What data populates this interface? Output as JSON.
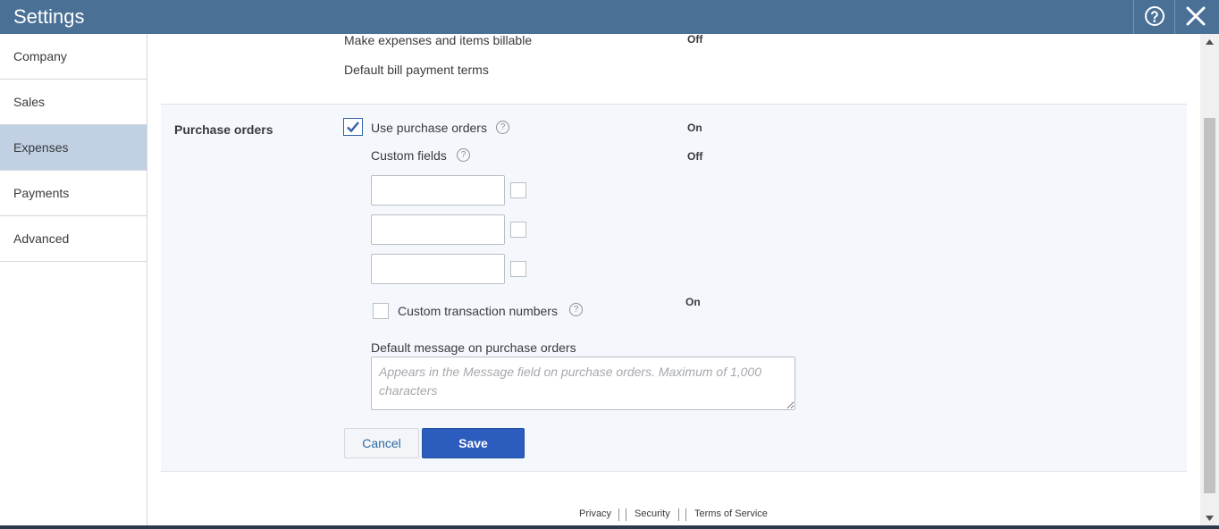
{
  "header": {
    "title": "Settings",
    "help_icon": "help-circle-icon",
    "close_icon": "close-icon"
  },
  "sidebar": {
    "items": [
      {
        "label": "Company",
        "active": false
      },
      {
        "label": "Sales",
        "active": false
      },
      {
        "label": "Expenses",
        "active": true
      },
      {
        "label": "Payments",
        "active": false
      },
      {
        "label": "Advanced",
        "active": false
      }
    ]
  },
  "bills": {
    "billable_label": "Make expenses and items billable",
    "billable_value": "Off",
    "payment_terms_label": "Default bill payment terms",
    "payment_terms_value": ""
  },
  "purchase_orders": {
    "section_title": "Purchase orders",
    "use_po_label": "Use purchase orders",
    "use_po_checked": true,
    "use_po_value": "On",
    "custom_fields_label": "Custom fields",
    "custom_fields_value": "Off",
    "custom_fields": [
      {
        "name": "",
        "public": false
      },
      {
        "name": "",
        "public": false
      },
      {
        "name": "",
        "public": false
      }
    ],
    "custom_txn_label": "Custom transaction numbers",
    "custom_txn_checked": false,
    "custom_txn_value": "On",
    "default_message_label": "Default message on purchase orders",
    "default_message_placeholder": "Appears in the Message field on purchase orders. Maximum of 1,000 characters",
    "default_message_value": "",
    "cancel_label": "Cancel",
    "save_label": "Save"
  },
  "footer": {
    "privacy": "Privacy",
    "security": "Security",
    "terms": "Terms of Service"
  },
  "colors": {
    "header_bg": "#4a7096",
    "active_nav_bg": "#c1d0e3",
    "section_bg": "#f4f8fc",
    "save_bg": "#2c5cbd",
    "link_blue": "#2d6aa6"
  }
}
